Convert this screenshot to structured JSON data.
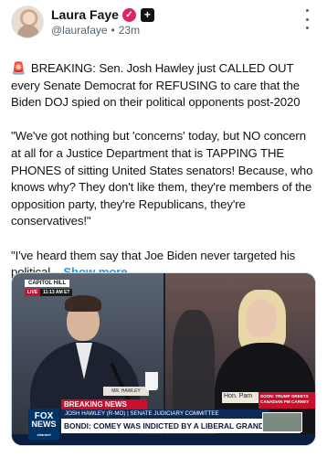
{
  "author": {
    "name": "Laura Faye",
    "handle": "@laurafaye",
    "separator": "•",
    "time": "23m",
    "verified_glyph": "✓",
    "plus_glyph": "+"
  },
  "colors": {
    "accent": "#1d9bf0",
    "verified": "#e0245e",
    "text": "#0f1419",
    "muted": "#536471"
  },
  "icons": {
    "more": "more-icon",
    "siren": "siren-icon"
  },
  "post": {
    "siren_glyph": "🚨",
    "paragraph1": "BREAKING: Sen. Josh Hawley just CALLED OUT every Senate Democrat for REFUSING to care that the Biden DOJ spied on their political opponents post-2020",
    "paragraph2": "\"We've got nothing but 'concerns' today, but NO concern at all for a Justice Department that is TAPPING THE PHONES of sitting United States senators! Because, who knows why? They don't like them, they're members of the opposition party, they're Republicans, they're conservatives!\"",
    "paragraph3": "\"I've heard them say that Joe Biden never targeted his political...",
    "show_more": "Show more"
  },
  "media": {
    "location_tag": "CAPITOL HILL",
    "live_label": "LIVE",
    "live_time": "11:13 AM ET",
    "nameplate_left": "MR. HAWLEY",
    "nameplate_right": "Hon. Pam",
    "soon_box": "SOON: TRUMP GREETS CANADIAN PM CARNEY",
    "logo_fox": "FOX",
    "logo_news": "NEWS",
    "logo_channel": "channel",
    "breaking_label": "BREAKING NEWS",
    "subline": "JOSH HAWLEY (R-MO) | SENATE JUDICIARY COMMITTEE",
    "headline": "BONDI: COMEY WAS INDICTED BY A LIBERAL GRAND JURY"
  }
}
